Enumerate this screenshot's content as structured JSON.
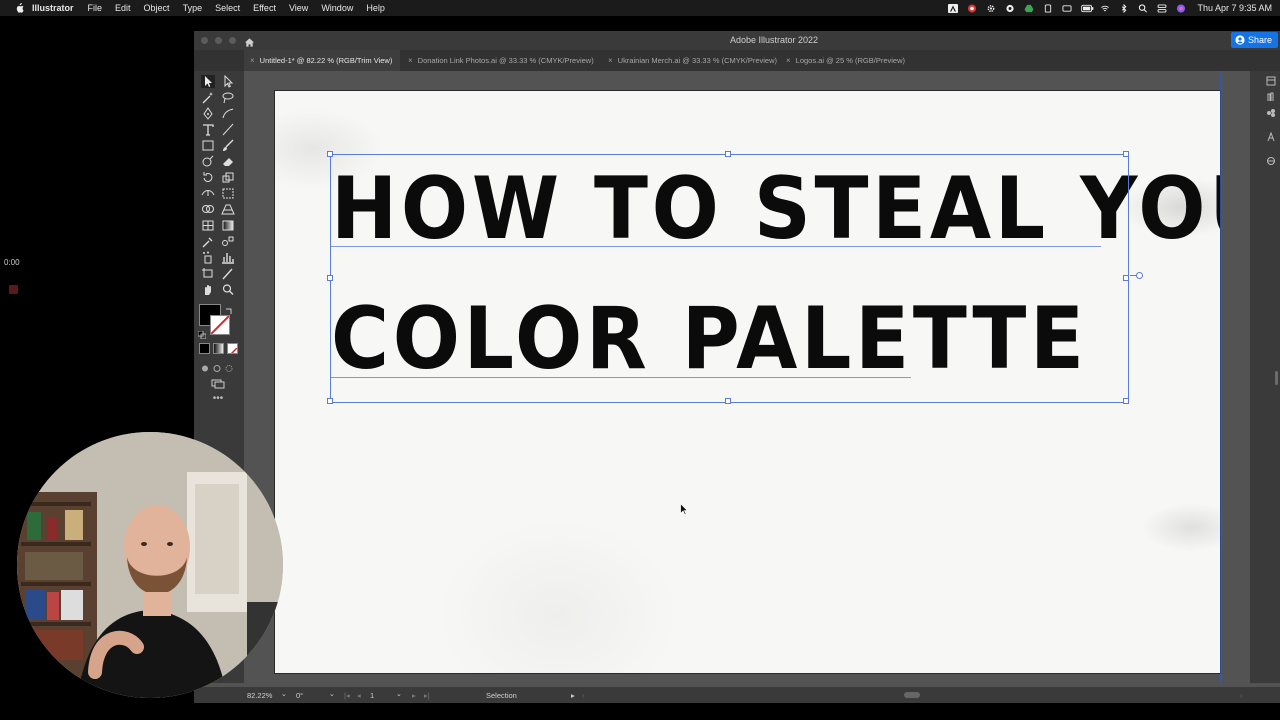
{
  "menubar": {
    "app_name": "Illustrator",
    "menus": [
      "File",
      "Edit",
      "Object",
      "Type",
      "Select",
      "Effect",
      "View",
      "Window",
      "Help"
    ],
    "clock": "Thu Apr 7  9:35 AM"
  },
  "timer": "0:00",
  "window": {
    "title": "Adobe Illustrator 2022",
    "share_label": "Share",
    "tabs": [
      {
        "label": "Untitled-1* @ 82.22 % (RGB/Trim View)",
        "active": true
      },
      {
        "label": "Donation Link Photos.ai @ 33.33 % (CMYK/Preview)",
        "active": false
      },
      {
        "label": "Ukrainian Merch.ai @ 33.33 % (CMYK/Preview)",
        "active": false
      },
      {
        "label": "Logos.ai @ 25 % (RGB/Preview)",
        "active": false
      }
    ]
  },
  "artboard": {
    "headline_line1": "HOW TO STEAL YOUR",
    "headline_line2": "COLOR PALETTE"
  },
  "statusbar": {
    "zoom": "82.22%",
    "rotation": "0°",
    "artboard_number": "1",
    "current_tool": "Selection"
  },
  "colors": {
    "accent": "#1473e6",
    "selection": "#5a7cd8",
    "fill_swatch": "#000000"
  }
}
